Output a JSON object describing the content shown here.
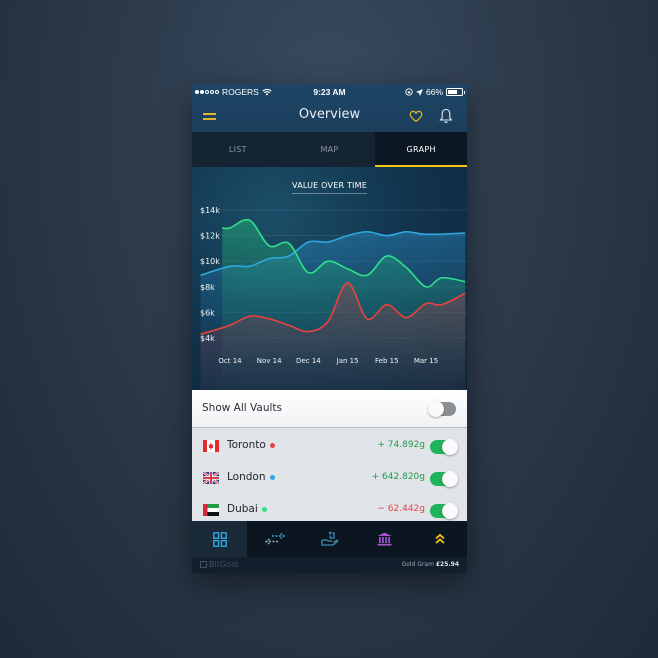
{
  "status_bar": {
    "carrier": "ROGERS",
    "signal_bars_filled": 2,
    "signal_bars_total": 5,
    "time": "9:23 AM",
    "battery": "66%",
    "battery_level": 0.66
  },
  "header": {
    "title": "Overview",
    "icons": [
      "menu-icon",
      "heart-icon",
      "bell-icon"
    ]
  },
  "tabs": [
    {
      "label": "LIST",
      "active": false
    },
    {
      "label": "MAP",
      "active": false
    },
    {
      "label": "GRAPH",
      "active": true
    }
  ],
  "chart_data": {
    "type": "area",
    "title": "VALUE OVER TIME",
    "xlabel": "",
    "ylabel": "",
    "categories": [
      "Oct 14",
      "Nov 14",
      "Dec 14",
      "Jan 15",
      "Feb 15",
      "Mar 15"
    ],
    "y_ticks": [
      "$4k",
      "$6k",
      "$8k",
      "$10k",
      "$12k",
      "$14k"
    ],
    "ylim": [
      4000,
      14000
    ],
    "grid": true,
    "x_domain": [
      -0.75,
      6.0
    ],
    "series": [
      {
        "name": "London",
        "color": "#2fa8e0",
        "x": [
          -0.75,
          0,
          0.5,
          1,
          1.5,
          2,
          2.5,
          3,
          3.5,
          4,
          4.5,
          5,
          6
        ],
        "values": [
          8900,
          9600,
          9600,
          10200,
          10400,
          11500,
          11500,
          12000,
          12300,
          12000,
          12300,
          12100,
          12200
        ]
      },
      {
        "name": "Dubai",
        "color": "#2fe08a",
        "x": [
          -0.2,
          0,
          0.5,
          1,
          1.5,
          2,
          2.5,
          3,
          3.5,
          4,
          4.5,
          5,
          5.4,
          6
        ],
        "values": [
          12600,
          12600,
          13200,
          11200,
          11400,
          9100,
          10000,
          9400,
          8900,
          10400,
          9500,
          8000,
          8700,
          8400
        ]
      },
      {
        "name": "Toronto",
        "color": "#e8433e",
        "x": [
          -0.75,
          0,
          0.5,
          1,
          1.5,
          2,
          2.5,
          3,
          3.5,
          4,
          4.5,
          5,
          5.4,
          6
        ],
        "values": [
          4300,
          5000,
          5700,
          5500,
          5000,
          4500,
          5300,
          8300,
          5500,
          6600,
          5600,
          6700,
          6600,
          7500
        ]
      }
    ]
  },
  "vaults": {
    "show_all_label": "Show All Vaults",
    "show_all_enabled": false,
    "items": [
      {
        "city": "Toronto",
        "flag": "canada-flag",
        "dot_color": "#e8433e",
        "change": "+ 74.892g",
        "direction": "positive",
        "enabled": true
      },
      {
        "city": "London",
        "flag": "uk-flag",
        "dot_color": "#2fa8e0",
        "change": "+ 642.820g",
        "direction": "positive",
        "enabled": true
      },
      {
        "city": "Dubai",
        "flag": "uae-flag",
        "dot_color": "#2fe08a",
        "change": "− 62.442g",
        "direction": "negative",
        "enabled": true
      }
    ]
  },
  "bottom_nav": [
    {
      "name": "dashboard",
      "icon": "grid-icon",
      "color": "#2fa8e0",
      "active": true
    },
    {
      "name": "transfer",
      "icon": "transfer-arrows-icon",
      "color": "#2fa8e0",
      "active": false
    },
    {
      "name": "deposit",
      "icon": "hand-coin-icon",
      "color": "#3a8fb3",
      "active": false
    },
    {
      "name": "bank",
      "icon": "bank-icon",
      "color": "#9a55c9",
      "active": false
    },
    {
      "name": "more",
      "icon": "chevrons-up-icon",
      "color": "#f5c518",
      "active": false
    }
  ],
  "footer": {
    "brand": "BitGold",
    "price_label": "Gold Gram",
    "price_value": "£25.94"
  }
}
